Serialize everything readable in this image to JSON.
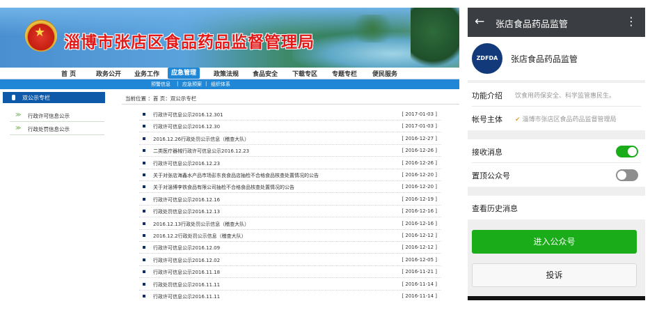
{
  "site": {
    "title": "淄博市张店区食品药品监督管理局",
    "nav": [
      "首 页",
      "政务公开",
      "业务工作",
      "应急管理",
      "政策法规",
      "食品安全",
      "下载专区",
      "专题专栏",
      "便民服务"
    ],
    "nav_active": "应急管理",
    "subnav": [
      "预警信息",
      "|",
      "应急预案",
      "|",
      "组织体系"
    ],
    "sidebar": {
      "heading": "双公示专栏",
      "items": [
        "行政许可信息公示",
        "行政处罚信息公示"
      ]
    },
    "breadcrumb": "当前位置 ：首 页：双公示专栏",
    "news": [
      {
        "title": "行政许可信息公示2016.12.301",
        "date": "[ 2017-01-03 ]"
      },
      {
        "title": "行政许可信息公示2016.12.30",
        "date": "[ 2017-01-03 ]"
      },
      {
        "title": "2016.12.26行政处罚公示信息（稽查大队）",
        "date": "[ 2016-12-27 ]"
      },
      {
        "title": "二类医疗器械行政许可信息公示2016.12.23",
        "date": "[ 2016-12-26 ]"
      },
      {
        "title": "行政许可信息公示2016.12.23",
        "date": "[ 2016-12-26 ]"
      },
      {
        "title": "关于对张店海鑫水产品市场彭东良食品店抽检不合格食品核查处置情况的公告",
        "date": "[ 2016-12-20 ]"
      },
      {
        "title": "关于对淄博李铁食品有限公司抽检不合格食品核查处置情况的公告",
        "date": "[ 2016-12-20 ]"
      },
      {
        "title": "行政许可信息公示2016.12.16",
        "date": "[ 2016-12-19 ]"
      },
      {
        "title": "行政处罚信息公示2016.12.13",
        "date": "[ 2016-12-16 ]"
      },
      {
        "title": "2016.12.13行政处罚公示信息（稽查大队）",
        "date": "[ 2016-12-16 ]"
      },
      {
        "title": "2016.12.2行政处罚公示信息（稽查大队）",
        "date": "[ 2016-12-12 ]"
      },
      {
        "title": "行政许可信息公示2016.12.09",
        "date": "[ 2016-12-12 ]"
      },
      {
        "title": "行政许可信息公示2016.12.02",
        "date": "[ 2016-12-05 ]"
      },
      {
        "title": "行政许可信息公示2016.11.18",
        "date": "[ 2016-11-21 ]"
      },
      {
        "title": "行政处罚信息公示2016.11.11",
        "date": "[ 2016-11-14 ]"
      },
      {
        "title": "行政许可信息公示2016.11.11",
        "date": "[ 2016-11-14 ]"
      }
    ]
  },
  "phone": {
    "topbar_title": "张店食品药品监管",
    "avatar_text": "ZDFDA",
    "account_name": "张店食品药品监管",
    "intro_label": "功能介绍",
    "intro_value": "饮食用药保安全、科学监管惠民生。",
    "owner_label": "帐号主体",
    "owner_value": "淄博市张店区食品药品监督管理局",
    "receive_label": "接收消息",
    "receive_on": true,
    "pin_label": "置顶公众号",
    "pin_on": false,
    "history_label": "查看历史消息",
    "enter_button": "进入公众号",
    "complain_button": "投诉",
    "accent_green": "#1aad19"
  }
}
